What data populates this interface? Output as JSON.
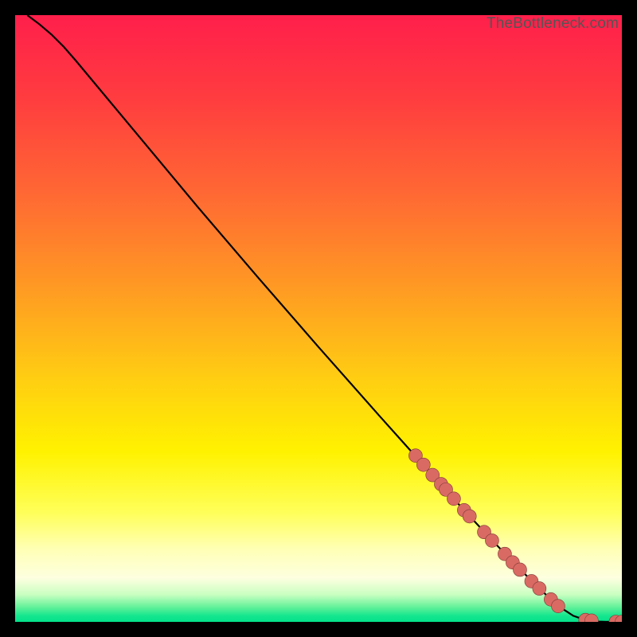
{
  "watermark": "TheBottleneck.com",
  "colors": {
    "marker_fill": "#d96a63",
    "marker_stroke": "#7c3a35",
    "line_stroke": "#000000",
    "gradient_stops": [
      {
        "offset": 0.0,
        "color": "#ff1f4b"
      },
      {
        "offset": 0.14,
        "color": "#ff3d3f"
      },
      {
        "offset": 0.3,
        "color": "#ff6a33"
      },
      {
        "offset": 0.45,
        "color": "#ff9a23"
      },
      {
        "offset": 0.6,
        "color": "#ffce12"
      },
      {
        "offset": 0.72,
        "color": "#fff200"
      },
      {
        "offset": 0.82,
        "color": "#ffff5a"
      },
      {
        "offset": 0.88,
        "color": "#ffffb5"
      },
      {
        "offset": 0.928,
        "color": "#fdffe0"
      },
      {
        "offset": 0.955,
        "color": "#c9ffc1"
      },
      {
        "offset": 0.975,
        "color": "#66f29a"
      },
      {
        "offset": 0.99,
        "color": "#14e68e"
      },
      {
        "offset": 1.0,
        "color": "#04e28b"
      }
    ]
  },
  "chart_data": {
    "type": "line",
    "title": "",
    "xlabel": "",
    "ylabel": "",
    "xlim": [
      0,
      100
    ],
    "ylim": [
      0,
      100
    ],
    "legend": false,
    "grid": false,
    "series": [
      {
        "name": "curve",
        "kind": "line",
        "x": [
          2,
          4,
          6,
          8,
          10,
          15,
          20,
          30,
          40,
          50,
          60,
          66,
          70,
          74,
          78,
          82,
          86,
          88,
          90,
          92,
          94,
          96,
          98,
          100
        ],
        "y": [
          100,
          98.5,
          96.8,
          94.8,
          92.5,
          86.5,
          80.5,
          68.5,
          56.8,
          45.3,
          34.0,
          27.3,
          22.8,
          18.4,
          14.1,
          9.9,
          5.9,
          4.0,
          2.3,
          1.0,
          0.3,
          0.05,
          0.0,
          0.0
        ]
      },
      {
        "name": "markers",
        "kind": "scatter",
        "x": [
          66.0,
          67.3,
          68.8,
          70.2,
          71.0,
          72.3,
          74.0,
          74.9,
          77.3,
          78.6,
          80.7,
          82.0,
          83.2,
          85.1,
          86.4,
          88.3,
          89.5,
          94.0,
          95.0,
          99.0,
          100.0
        ],
        "y": [
          27.4,
          25.9,
          24.2,
          22.7,
          21.8,
          20.3,
          18.4,
          17.4,
          14.8,
          13.4,
          11.2,
          9.8,
          8.6,
          6.7,
          5.5,
          3.7,
          2.6,
          0.3,
          0.2,
          0.0,
          0.0
        ]
      }
    ]
  }
}
